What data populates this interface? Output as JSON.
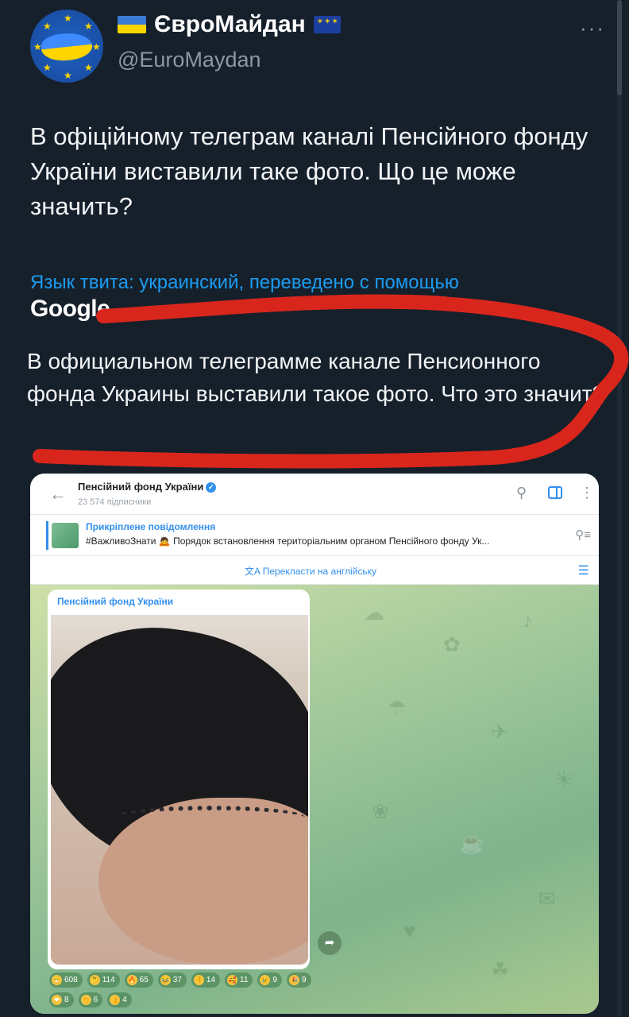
{
  "tweet": {
    "display_name": "ЄвроМайдан",
    "handle": "@EuroMaydan",
    "more_label": "···",
    "text": "В офіційному телеграм каналі Пенсійного фонду України виставили таке фото. Що це може значить?",
    "translation_link": "Язык твита: украинский, переведено с помощью",
    "translation_provider": "Google",
    "translated_text": "В официальном телеграмме канале Пенсионного фонда Украины выставили такое фото. Что это значит?"
  },
  "telegram": {
    "channel_name": "Пенсійний фонд України",
    "subscribers": "23 574 підписники",
    "pinned_title": "Прикріплене повідомлення",
    "pinned_text": "#ВажливоЗнати 🙇 Порядок встановлення територіальним органом Пенсійного фонду Ук...",
    "translate_label": "Перекласти на англійську",
    "bubble_sender": "Пенсійний фонд України",
    "reactions": [
      {
        "emoji": "😁",
        "count": "608"
      },
      {
        "emoji": "🤔",
        "count": "114"
      },
      {
        "emoji": "🔥",
        "count": "65"
      },
      {
        "emoji": "😂",
        "count": "37"
      },
      {
        "emoji": "👎",
        "count": "14"
      },
      {
        "emoji": "🥰",
        "count": "11"
      },
      {
        "emoji": "😢",
        "count": "9"
      },
      {
        "emoji": "🎉",
        "count": "9"
      },
      {
        "emoji": "❤",
        "count": "8"
      },
      {
        "emoji": "👏",
        "count": "6"
      },
      {
        "emoji": "👍",
        "count": "4"
      }
    ]
  },
  "colors": {
    "background": "#15202b",
    "link": "#1d9bf0",
    "scribble": "#d9261c",
    "telegram_accent": "#3390ec"
  },
  "icons": {
    "back": "arrow-left-icon",
    "search": "search-icon",
    "sidebar": "sidebar-icon",
    "menu": "kebab-menu-icon",
    "pin": "pin-list-icon",
    "translate": "translate-icon",
    "filter": "filter-icon",
    "forward": "forward-icon"
  }
}
